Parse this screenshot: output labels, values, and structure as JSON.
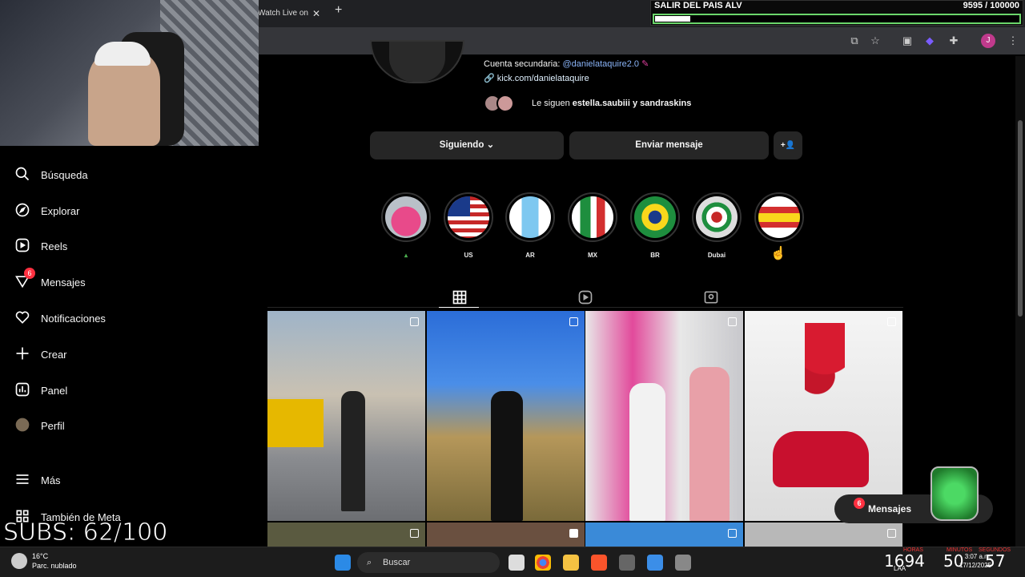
{
  "browser": {
    "tab_title": "Watch Live on",
    "new_tab": "+",
    "tab_close": "✕",
    "profile_initial": "J"
  },
  "goal_overlay": {
    "title": "SALIR DEL PAIS ALV",
    "count": "9595  / 100000",
    "progress": 0.0959
  },
  "sidebar": {
    "items": [
      {
        "label": "Búsqueda",
        "icon": "search-icon"
      },
      {
        "label": "Explorar",
        "icon": "compass-icon"
      },
      {
        "label": "Reels",
        "icon": "reels-icon"
      },
      {
        "label": "Mensajes",
        "icon": "messenger-icon",
        "badge": "6"
      },
      {
        "label": "Notificaciones",
        "icon": "heart-icon"
      },
      {
        "label": "Crear",
        "icon": "plus-icon"
      },
      {
        "label": "Panel",
        "icon": "chart-icon"
      },
      {
        "label": "Perfil",
        "icon": "profile-avatar-icon"
      },
      {
        "label": "Más",
        "icon": "menu-icon"
      },
      {
        "label": "También de Meta",
        "icon": "meta-grid-icon"
      }
    ]
  },
  "overlay_subs": "SUBS: 62/100",
  "profile": {
    "secondary_label": "Cuenta secundaria:",
    "secondary_handle": "@danielataquire2.0",
    "link": "kick.com/danielataquire",
    "followed_prefix": "Le siguen ",
    "followed_names": "estella.saubiii y sandraskins"
  },
  "actions": {
    "following": "Siguiendo",
    "message": "Enviar mensaje",
    "add_user": "+👤"
  },
  "highlights": [
    {
      "label": "",
      "icon": "green-marker-icon"
    },
    {
      "label": "US"
    },
    {
      "label": "AR"
    },
    {
      "label": "MX"
    },
    {
      "label": "BR"
    },
    {
      "label": "Dubai"
    },
    {
      "label": ""
    }
  ],
  "messages_pill": {
    "label": "Mensajes",
    "badge": "6"
  },
  "taskbar": {
    "temp": "16°C",
    "weather": "Parc. nublado",
    "search": "Buscar",
    "time": "3:07 a.m.",
    "date": "17/12/2025",
    "lang": "LAA",
    "overlay_timer": [
      "1694",
      "50",
      "57"
    ],
    "timer_labels": [
      "HORAS",
      "MINUTOS",
      "SEGUNDOS"
    ]
  },
  "colors": {
    "accent_link": "#8ab4f8",
    "badge_red": "#ff3040",
    "goal_green": "#6bd66b"
  }
}
